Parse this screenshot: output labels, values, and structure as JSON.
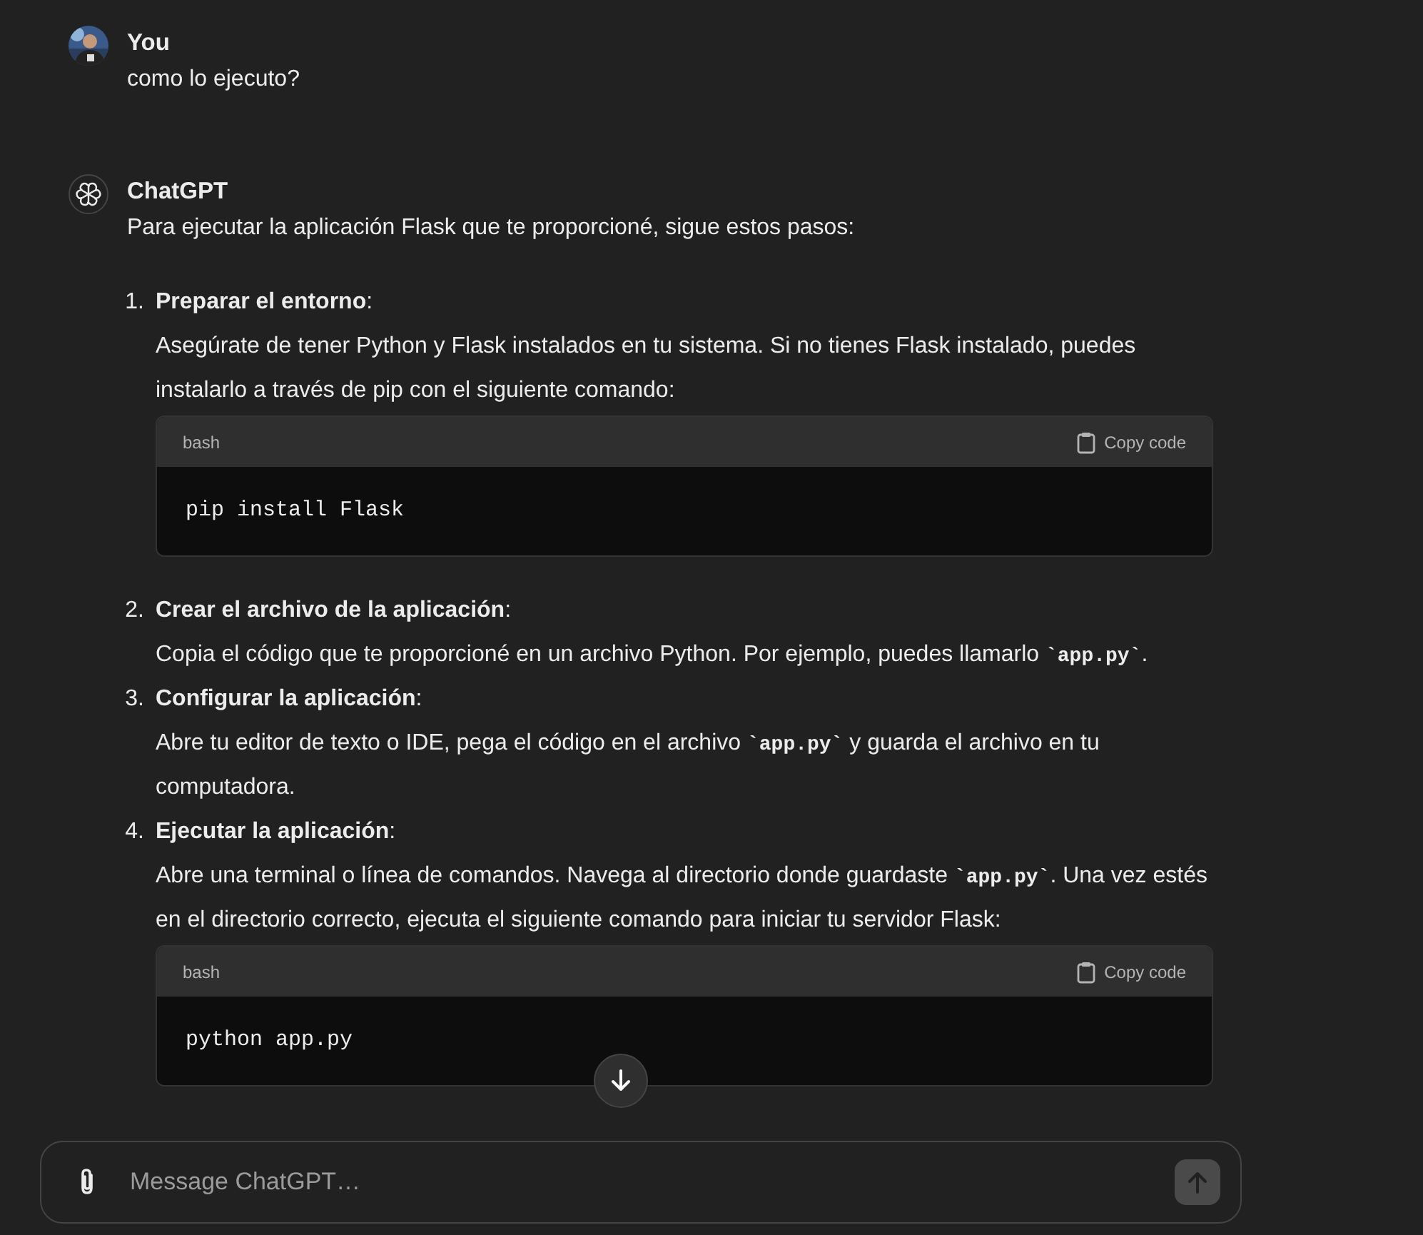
{
  "messages": [
    {
      "author": "You",
      "kind": "user",
      "text": "como lo ejecuto?"
    },
    {
      "author": "ChatGPT",
      "kind": "assistant",
      "text": "Para ejecutar la aplicación Flask que te proporcioné, sigue estos pasos:",
      "steps": [
        {
          "number": "1.",
          "title": "**Preparar el entorno**:",
          "body": [
            {
              "kind": "text",
              "text": "Asegúrate de tener Python y Flask instalados en tu sistema. Si no tienes Flask instalado, puedes instalarlo a través de pip con el siguiente comando:"
            }
          ],
          "code": {
            "language": "bash",
            "copy_label": "Copy code",
            "code": "pip install Flask"
          }
        },
        {
          "number": "2.",
          "title": "**Crear el archivo de la aplicación**:",
          "body": [
            {
              "kind": "text",
              "text": "Copia el código que te proporcioné en un archivo Python. Por ejemplo, puedes llamarlo "
            },
            {
              "kind": "code",
              "text": "`app.py`"
            },
            {
              "kind": "text",
              "text": "."
            }
          ]
        },
        {
          "number": "3.",
          "title": "**Configurar la aplicación**:",
          "body": [
            {
              "kind": "text",
              "text": "Abre tu editor de texto o IDE, pega el código en el archivo "
            },
            {
              "kind": "code",
              "text": "`app.py`"
            },
            {
              "kind": "text",
              "text": " y guarda el archivo en tu computadora."
            }
          ]
        },
        {
          "number": "4.",
          "title": "**Ejecutar la aplicación**:",
          "body": [
            {
              "kind": "text",
              "text": "Abre una terminal o línea de comandos. Navega al directorio donde guardaste "
            },
            {
              "kind": "code",
              "text": "`app.py`"
            },
            {
              "kind": "text",
              "text": ". Una vez estés en el directorio correcto, ejecuta el siguiente comando para iniciar tu servidor Flask:"
            }
          ],
          "code": {
            "language": "bash",
            "copy_label": "Copy code",
            "code": "python app.py"
          }
        }
      ]
    }
  ],
  "composer": {
    "placeholder": "Message ChatGPT…"
  }
}
